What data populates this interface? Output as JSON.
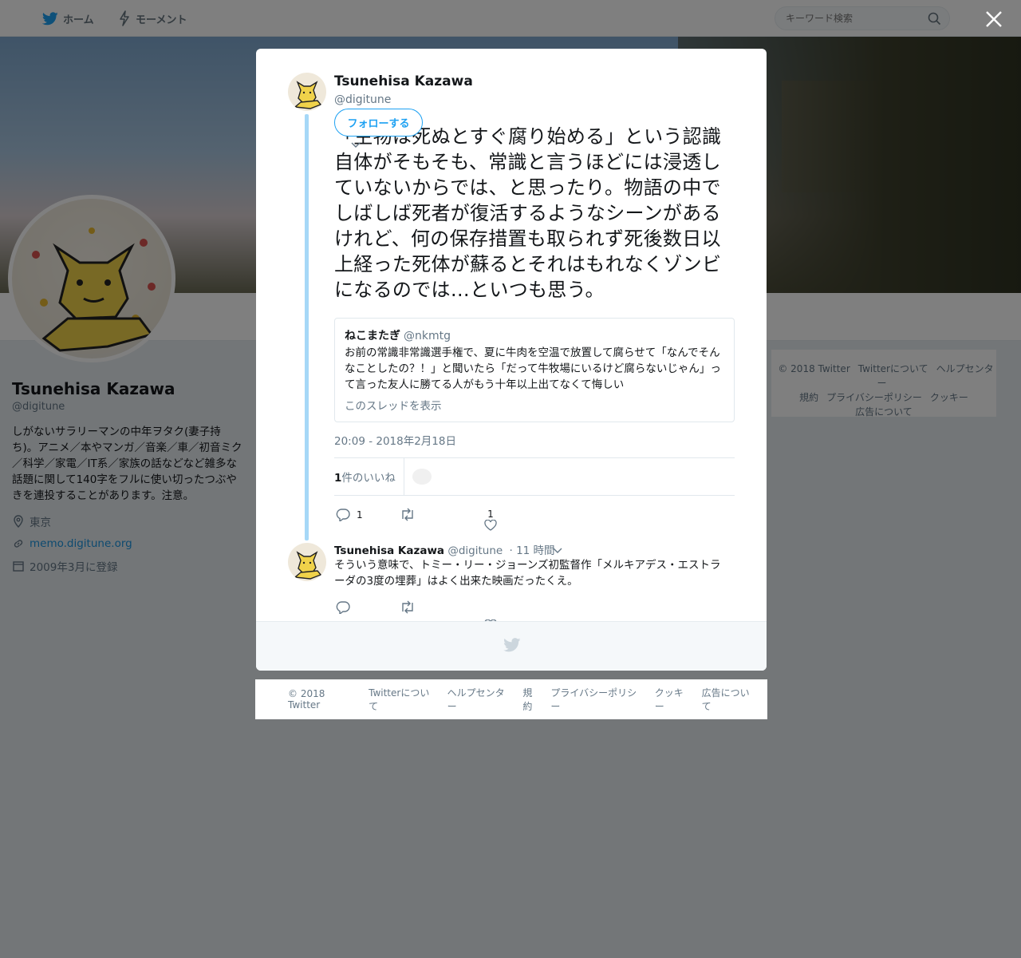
{
  "topbar": {
    "home_label": "ホーム",
    "moments_label": "モーメント",
    "search_placeholder": "キーワード検索"
  },
  "profile": {
    "name": "Tsunehisa Kazawa",
    "handle": "@digitune",
    "bio": "しがないサラリーマンの中年ヲタク(妻子持ち)。アニメ／本やマンガ／音楽／車／初音ミク／科学／家電／IT系／家族の話などなど雑多な話題に関して140字をフルに使い切ったつぶやきを連投することがあります。注意。",
    "location": "東京",
    "url": "memo.digitune.org",
    "joined": "2009年3月に登録"
  },
  "right_footer": {
    "links": [
      "© 2018 Twitter",
      "Twitterについて",
      "ヘルプセンター",
      "規約",
      "プライバシーポリシー",
      "クッキー",
      "広告について"
    ]
  },
  "tweet": {
    "author_name": "Tsunehisa Kazawa",
    "author_handle": "@digitune",
    "follow_label": "フォローする",
    "text": "「生物は死ぬとすぐ腐り始める」という認識自体がそもそも、常識と言うほどには浸透していないからでは、と思ったり。物語の中でしばしば死者が復活するようなシーンがあるけれど、何の保存措置も取られず死後数日以上経った死体が蘇るとそれはもれなくゾンビになるのでは…といつも思う。",
    "quote": {
      "name": "ねこまたぎ",
      "handle": "@nkmtg",
      "text": "お前の常識非常識選手権で、夏に牛肉を空温で放置して腐らせて「なんでそんなことしたの？！」と聞いたら「だって牛牧場にいるけど腐らないじゃん」って言った友人に勝てる人がもう十年以上出てなくて悔しい",
      "thread_link": "このスレッドを表示"
    },
    "timestamp": "20:09 - 2018年2月18日",
    "likes_count": "1",
    "likes_label": "件のいいね",
    "reply_count": "1",
    "like_count_action": "1"
  },
  "reply": {
    "author_name": "Tsunehisa Kazawa",
    "author_handle": "@digitune",
    "time": "· 11 時間",
    "text": "そういう意味で、トミー・リー・ジョーンズ初監督作「メルキアデス・エストラーダの3度の埋葬」はよく出来た映画だったくえ。"
  },
  "bottom_footer": {
    "links": [
      "© 2018 Twitter",
      "Twitterについて",
      "ヘルプセンター",
      "規約",
      "プライバシーポリシー",
      "クッキー",
      "広告について"
    ]
  },
  "colors": {
    "accent": "#1da1f2",
    "thread_line": "#a6d8f7",
    "overlay": "rgba(0,0,0,0.5)"
  },
  "icons": [
    "twitter-bird-icon",
    "lightning-icon",
    "search-icon",
    "close-icon",
    "location-icon",
    "link-icon",
    "calendar-icon",
    "reply-icon",
    "retweet-icon",
    "heart-icon",
    "chevron-down-icon"
  ]
}
